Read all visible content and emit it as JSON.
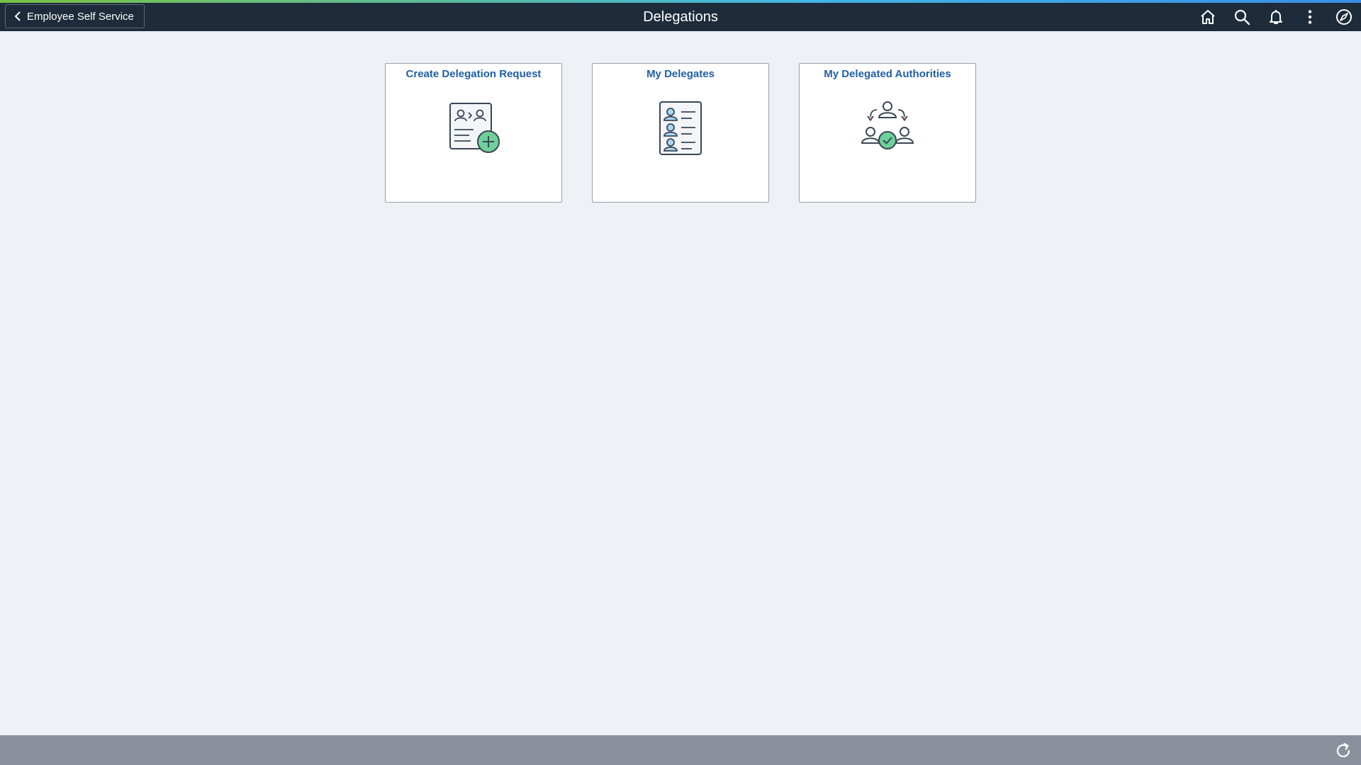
{
  "header": {
    "back_label": "Employee Self Service",
    "title": "Delegations",
    "icons": [
      "home-icon",
      "search-icon",
      "notifications-icon",
      "actions-menu-icon",
      "navbar-compass-icon"
    ]
  },
  "tiles": [
    {
      "title": "Create Delegation Request",
      "icon": "create-delegation-icon"
    },
    {
      "title": "My Delegates",
      "icon": "delegates-list-icon"
    },
    {
      "title": "My Delegated Authorities",
      "icon": "delegated-authorities-icon"
    }
  ],
  "footer": {
    "icon": "refresh-icon"
  },
  "colors": {
    "header_bg": "#1d2b3a",
    "page_bg": "#eef1f5",
    "tile_title": "#1f5fa6",
    "accent_green": "#6fd19a",
    "footer_bg": "#8a919c"
  }
}
